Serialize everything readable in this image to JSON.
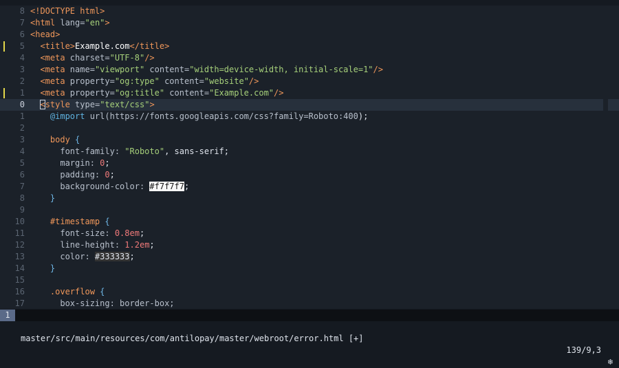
{
  "editor": {
    "lines": [
      {
        "num": "8",
        "mark": false,
        "current": false,
        "tokens": [
          {
            "t": "<!DOCTYPE html>",
            "c": "t-tag"
          }
        ]
      },
      {
        "num": "7",
        "mark": false,
        "current": false,
        "tokens": [
          {
            "t": "<html ",
            "c": "t-tag"
          },
          {
            "t": "lang",
            "c": "t-attr"
          },
          {
            "t": "=",
            "c": "t-attr"
          },
          {
            "t": "\"en\"",
            "c": "t-str"
          },
          {
            "t": ">",
            "c": "t-tag"
          }
        ]
      },
      {
        "num": "6",
        "mark": false,
        "current": false,
        "tokens": [
          {
            "t": "<head>",
            "c": "t-tag"
          }
        ]
      },
      {
        "num": "5",
        "mark": true,
        "current": false,
        "tokens": [
          {
            "t": "  <title>",
            "c": "t-tag"
          },
          {
            "t": "Example.com",
            "c": "t-bold"
          },
          {
            "t": "</title>",
            "c": "t-tag"
          }
        ]
      },
      {
        "num": "4",
        "mark": false,
        "current": false,
        "tokens": [
          {
            "t": "  <meta ",
            "c": "t-tag"
          },
          {
            "t": "charset",
            "c": "t-attr"
          },
          {
            "t": "=",
            "c": "t-attr"
          },
          {
            "t": "\"UTF-8\"",
            "c": "t-str"
          },
          {
            "t": "/>",
            "c": "t-tag"
          }
        ]
      },
      {
        "num": "3",
        "mark": false,
        "current": false,
        "tokens": [
          {
            "t": "  <meta ",
            "c": "t-tag"
          },
          {
            "t": "name",
            "c": "t-attr"
          },
          {
            "t": "=",
            "c": "t-attr"
          },
          {
            "t": "\"viewport\"",
            "c": "t-str"
          },
          {
            "t": " content",
            "c": "t-attr"
          },
          {
            "t": "=",
            "c": "t-attr"
          },
          {
            "t": "\"width=device-width, initial-scale=1\"",
            "c": "t-str"
          },
          {
            "t": "/>",
            "c": "t-tag"
          }
        ]
      },
      {
        "num": "2",
        "mark": false,
        "current": false,
        "tokens": [
          {
            "t": "  <meta ",
            "c": "t-tag"
          },
          {
            "t": "property",
            "c": "t-attr"
          },
          {
            "t": "=",
            "c": "t-attr"
          },
          {
            "t": "\"og:type\"",
            "c": "t-str"
          },
          {
            "t": " content",
            "c": "t-attr"
          },
          {
            "t": "=",
            "c": "t-attr"
          },
          {
            "t": "\"website\"",
            "c": "t-str"
          },
          {
            "t": "/>",
            "c": "t-tag"
          }
        ]
      },
      {
        "num": "1",
        "mark": true,
        "current": false,
        "tokens": [
          {
            "t": "  <meta ",
            "c": "t-tag"
          },
          {
            "t": "property",
            "c": "t-attr"
          },
          {
            "t": "=",
            "c": "t-attr"
          },
          {
            "t": "\"og:title\"",
            "c": "t-str"
          },
          {
            "t": " content",
            "c": "t-attr"
          },
          {
            "t": "=",
            "c": "t-attr"
          },
          {
            "t": "\"Example.com\"",
            "c": "t-str"
          },
          {
            "t": "/>",
            "c": "t-tag"
          }
        ]
      },
      {
        "num": "0",
        "mark": false,
        "current": true,
        "tokens": [
          {
            "t": "  ",
            "c": "t-plain"
          },
          {
            "t": "<",
            "c": "t-tag cursor"
          },
          {
            "t": "style ",
            "c": "t-tag"
          },
          {
            "t": "type",
            "c": "t-attr"
          },
          {
            "t": "=",
            "c": "t-attr"
          },
          {
            "t": "\"text/css\"",
            "c": "t-str"
          },
          {
            "t": ">",
            "c": "t-tag"
          }
        ]
      },
      {
        "num": "1",
        "mark": false,
        "current": false,
        "tokens": [
          {
            "t": "    ",
            "c": "t-plain"
          },
          {
            "t": "@import",
            "c": "t-kw"
          },
          {
            "t": " url(",
            "c": "t-url"
          },
          {
            "t": "https://fonts.googleapis.com/css?family=Roboto:400",
            "c": "t-url"
          },
          {
            "t": ");",
            "c": "t-plain"
          }
        ]
      },
      {
        "num": "2",
        "mark": false,
        "current": false,
        "tokens": []
      },
      {
        "num": "3",
        "mark": false,
        "current": false,
        "tokens": [
          {
            "t": "    body ",
            "c": "t-sel"
          },
          {
            "t": "{",
            "c": "t-brace"
          }
        ]
      },
      {
        "num": "4",
        "mark": false,
        "current": false,
        "tokens": [
          {
            "t": "      font-family: ",
            "c": "t-prop"
          },
          {
            "t": "\"Roboto\"",
            "c": "t-str"
          },
          {
            "t": ", sans-serif;",
            "c": "t-plain"
          }
        ]
      },
      {
        "num": "5",
        "mark": false,
        "current": false,
        "tokens": [
          {
            "t": "      margin: ",
            "c": "t-prop"
          },
          {
            "t": "0",
            "c": "t-num"
          },
          {
            "t": ";",
            "c": "t-plain"
          }
        ]
      },
      {
        "num": "6",
        "mark": false,
        "current": false,
        "tokens": [
          {
            "t": "      padding: ",
            "c": "t-prop"
          },
          {
            "t": "0",
            "c": "t-num"
          },
          {
            "t": ";",
            "c": "t-plain"
          }
        ]
      },
      {
        "num": "7",
        "mark": false,
        "current": false,
        "tokens": [
          {
            "t": "      background-color: ",
            "c": "t-prop"
          },
          {
            "t": "#f7f7f7",
            "c": "swatch-light"
          },
          {
            "t": ";",
            "c": "t-plain"
          }
        ]
      },
      {
        "num": "8",
        "mark": false,
        "current": false,
        "tokens": [
          {
            "t": "    }",
            "c": "t-brace"
          }
        ]
      },
      {
        "num": "9",
        "mark": false,
        "current": false,
        "tokens": []
      },
      {
        "num": "10",
        "mark": false,
        "current": false,
        "tokens": [
          {
            "t": "    #timestamp ",
            "c": "t-sel"
          },
          {
            "t": "{",
            "c": "t-brace"
          }
        ]
      },
      {
        "num": "11",
        "mark": false,
        "current": false,
        "tokens": [
          {
            "t": "      font-size: ",
            "c": "t-prop"
          },
          {
            "t": "0.8",
            "c": "t-num"
          },
          {
            "t": "em",
            "c": "t-num"
          },
          {
            "t": ";",
            "c": "t-plain"
          }
        ]
      },
      {
        "num": "12",
        "mark": false,
        "current": false,
        "tokens": [
          {
            "t": "      line-height: ",
            "c": "t-prop"
          },
          {
            "t": "1.2",
            "c": "t-num"
          },
          {
            "t": "em",
            "c": "t-num"
          },
          {
            "t": ";",
            "c": "t-plain"
          }
        ]
      },
      {
        "num": "13",
        "mark": false,
        "current": false,
        "tokens": [
          {
            "t": "      color: ",
            "c": "t-prop"
          },
          {
            "t": "#333333",
            "c": "swatch-dark"
          },
          {
            "t": ";",
            "c": "t-plain"
          }
        ]
      },
      {
        "num": "14",
        "mark": false,
        "current": false,
        "tokens": [
          {
            "t": "    }",
            "c": "t-brace"
          }
        ]
      },
      {
        "num": "15",
        "mark": false,
        "current": false,
        "tokens": []
      },
      {
        "num": "16",
        "mark": false,
        "current": false,
        "tokens": [
          {
            "t": "    .overflow ",
            "c": "t-sel"
          },
          {
            "t": "{",
            "c": "t-brace"
          }
        ]
      },
      {
        "num": "17",
        "mark": false,
        "current": false,
        "tokens": [
          {
            "t": "      box-sizing: border-box;",
            "c": "t-prop"
          }
        ]
      }
    ]
  },
  "statusbar": {
    "window_number": "1",
    "path": "master/src/main/resources/com/antilopay/master/webroot/error.html [+]",
    "position": "139/9,3",
    "icon": "❄",
    "icon_name": "snowflake-icon"
  },
  "colors": {
    "background": "#1b2129",
    "current_line": "#27303c",
    "tag": "#f0975a",
    "string": "#a6d07a",
    "number": "#f07a7a",
    "git_mark": "#e5d94a"
  }
}
